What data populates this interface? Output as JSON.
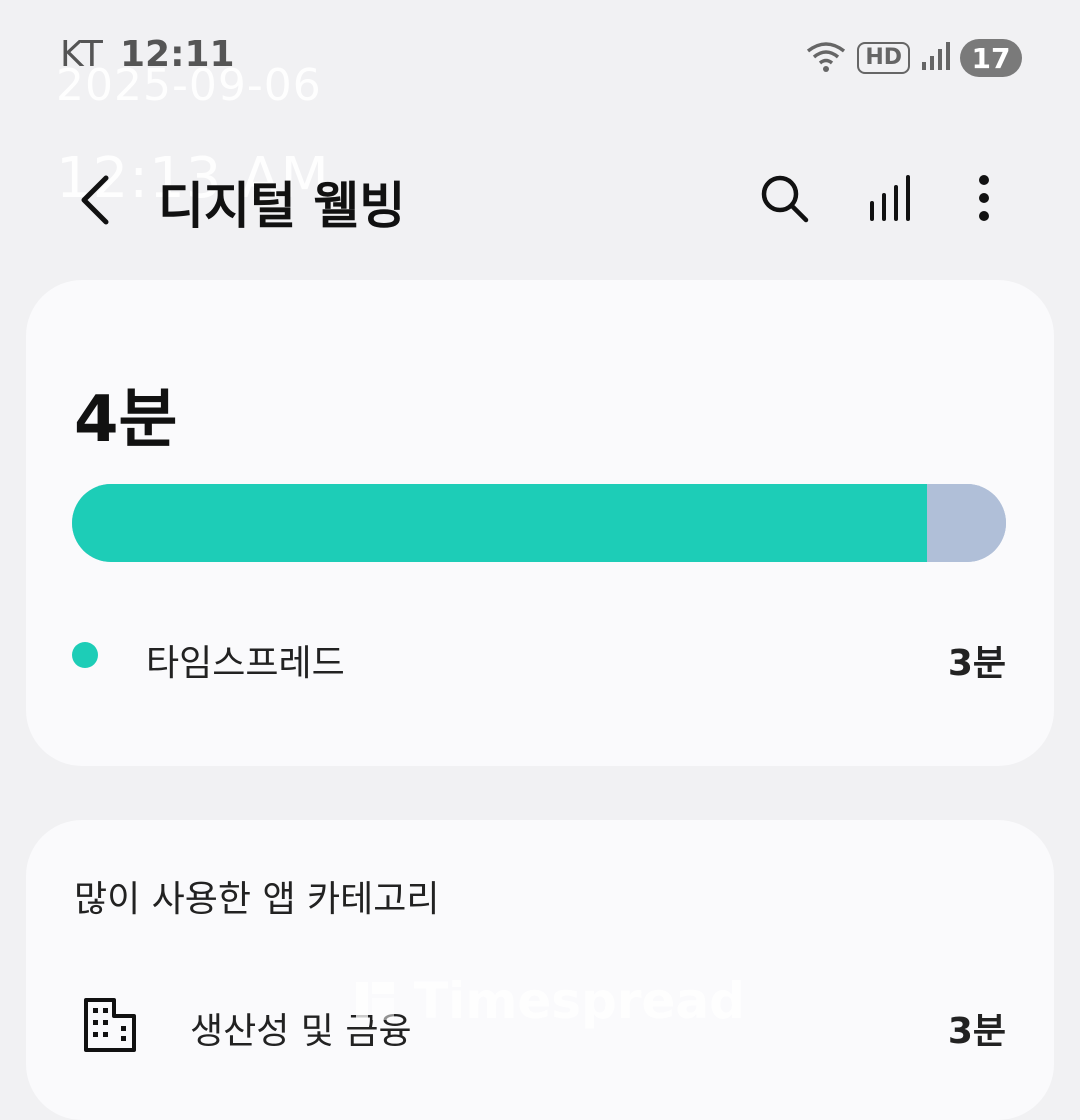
{
  "status_bar": {
    "carrier": "KT",
    "time": "12:11",
    "battery": "17",
    "hd": "HD",
    "icons": [
      "wifi-icon",
      "hd-icon",
      "signal-icon",
      "battery-icon"
    ]
  },
  "timestamp_overlay": {
    "date": "2025-09-06",
    "time": "12:13 AM"
  },
  "app_bar": {
    "title": "디지털 웰빙",
    "icons": [
      "back-icon",
      "search-icon",
      "stats-icon",
      "more-icon"
    ]
  },
  "usage_card": {
    "total": "4분",
    "bar": {
      "app_fraction": 0.915,
      "app_color": "#1dcdb7",
      "other_color": "#b0bfd8"
    },
    "legend": [
      {
        "label": "타임스프레드",
        "value": "3분",
        "color": "#1dcdb7"
      }
    ]
  },
  "category_card": {
    "title": "많이 사용한 앱 카테고리",
    "items": [
      {
        "label": "생산성 및 금융",
        "value": "3분",
        "icon": "building-icon"
      }
    ]
  },
  "watermark": {
    "text": "Timespread"
  }
}
